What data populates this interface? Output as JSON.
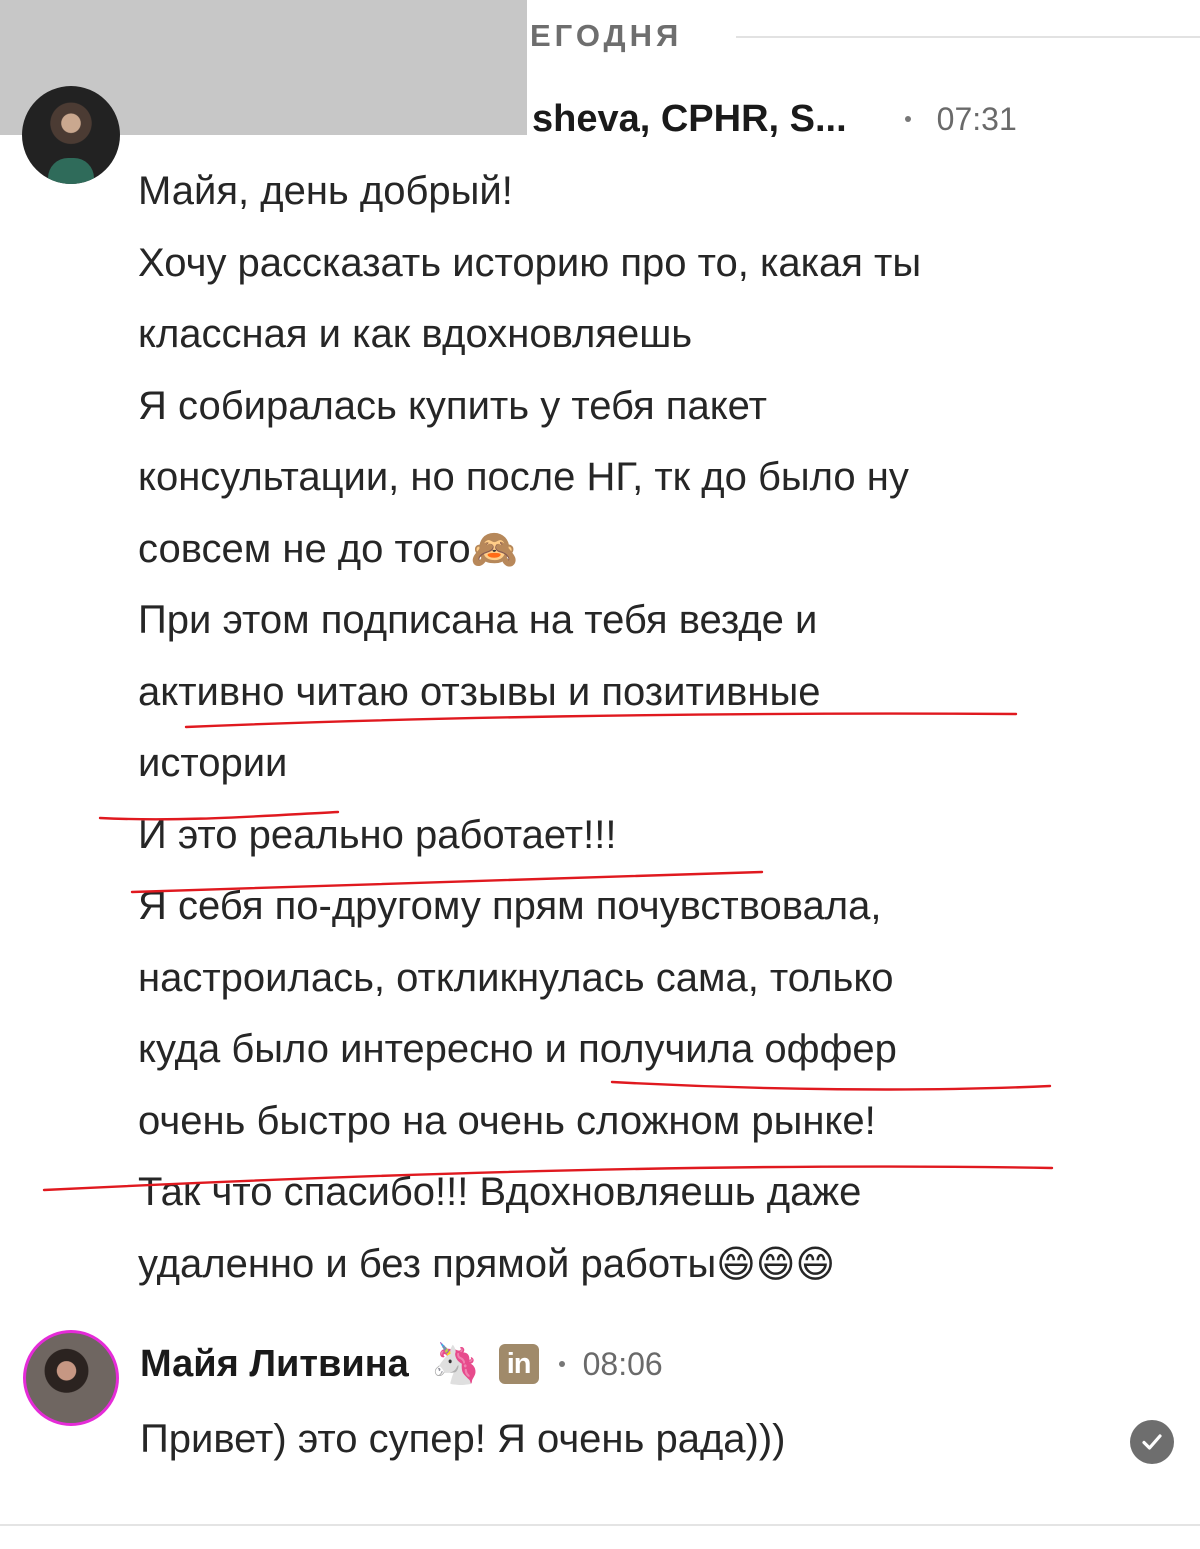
{
  "day_divider": {
    "label": "ЕГОДНЯ"
  },
  "messages": [
    {
      "sender": "sheva, CPHR, S...",
      "time": "07:31",
      "lines": [
        "Майя, день добрый!",
        "Хочу рассказать историю про то, какая ты",
        "классная и как вдохновляешь",
        "Я собиралась купить у тебя пакет",
        "консультации, но после НГ, тк до было ну",
        "совсем не до того",
        "При этом подписана на тебя везде и",
        "активно читаю отзывы и позитивные",
        "истории",
        "И это реально работает!!!",
        "Я себя по-другому прям почувствовала,",
        "настроилась, откликнулась сама, только",
        "куда было интересно и получила оффер",
        "очень быстро на очень сложном рынке!",
        "Так что спасибо!!! Вдохновляешь даже",
        "удаленно и без прямой работы"
      ],
      "line6_emoji": "🙈",
      "last_line_emoji": "😄😄😄"
    },
    {
      "sender": "Майя Литвина",
      "sender_emoji": "🦄",
      "badge": "in",
      "time": "08:06",
      "text": "Привет) это супер! Я очень рада)))"
    }
  ],
  "colors": {
    "annotation": "#e0191f",
    "avatar_ring": "#e52bd8",
    "redaction": "#c7c7c7"
  },
  "icons": [
    "avatar",
    "unicorn-emoji",
    "linkedin-badge",
    "seen-check-icon"
  ]
}
